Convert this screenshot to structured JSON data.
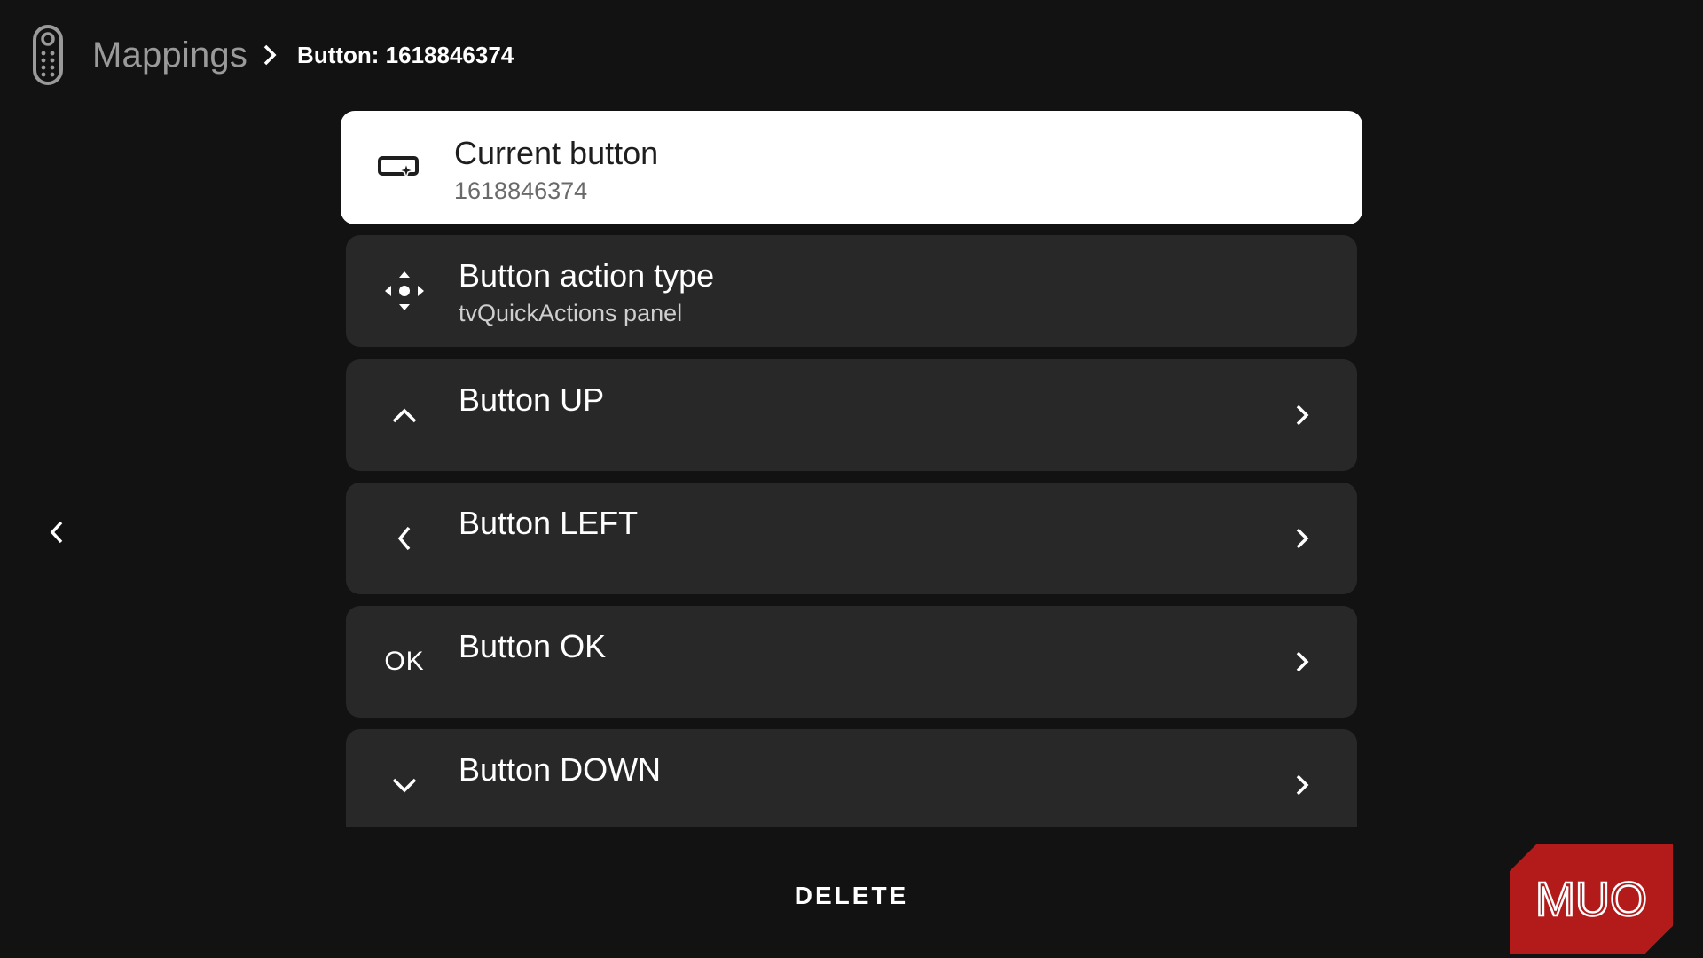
{
  "breadcrumb": {
    "root": "Mappings",
    "current": "Button: 1618846374"
  },
  "items": [
    {
      "title": "Current button",
      "subtitle": "1618846374",
      "icon": "remote-button-icon",
      "focused": true
    },
    {
      "title": "Button action type",
      "subtitle": "tvQuickActions panel",
      "icon": "dpad-icon"
    },
    {
      "title": "Button UP",
      "icon": "chevron-up-icon"
    },
    {
      "title": "Button LEFT",
      "icon": "chevron-left-icon"
    },
    {
      "title": "Button OK",
      "icon_text": "OK"
    },
    {
      "title": "Button DOWN",
      "icon": "chevron-down-icon"
    }
  ],
  "delete_label": "DELETE",
  "watermark": "MUO",
  "colors": {
    "background": "#121212",
    "card": "#282828",
    "focused_card": "#ffffff",
    "watermark": "#b31b1b"
  }
}
